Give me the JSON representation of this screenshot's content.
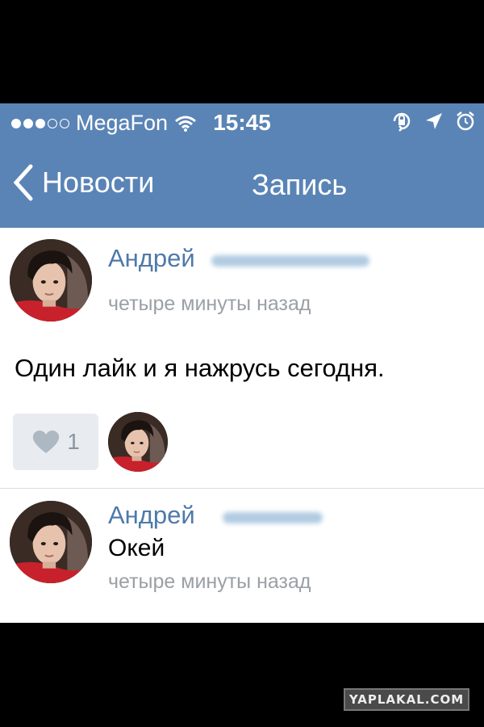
{
  "status_bar": {
    "signal_dots_filled": 3,
    "signal_dots_total": 5,
    "carrier": "MegaFon",
    "time": "15:45",
    "icons": [
      "signal-dots-icon",
      "wifi-icon",
      "rotation-lock-icon",
      "location-arrow-icon",
      "alarm-icon"
    ]
  },
  "nav": {
    "back_label": "Новости",
    "title": "Запись"
  },
  "post": {
    "author": "Андрей",
    "author_surname_blurred": true,
    "time": "четыре минуты назад",
    "text": "Один лайк и я нажрусь сегодня.",
    "likes": "1"
  },
  "comment": {
    "author": "Андрей",
    "author_surname_blurred": true,
    "text": "Окей",
    "time": "четыре минуты назад"
  },
  "watermark": "YAPLAKAL.COM",
  "colors": {
    "bar": "#5a84b5",
    "name": "#4e79ab",
    "meta": "#9aa0a6",
    "like_bg": "#e8ecf1"
  }
}
